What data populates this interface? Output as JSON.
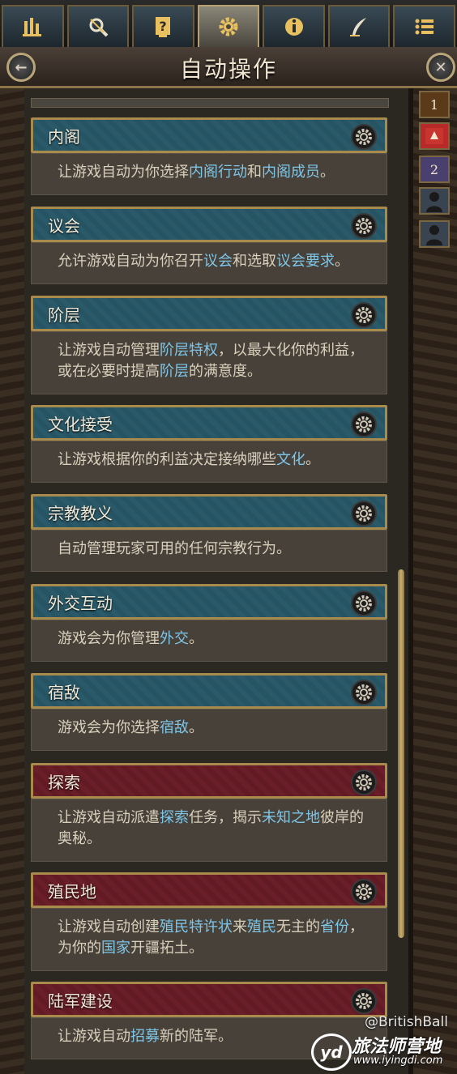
{
  "tabs": [
    {
      "icon": "bar-chart-icon"
    },
    {
      "icon": "magnifier-icon"
    },
    {
      "icon": "question-book-icon"
    },
    {
      "icon": "gear-icon"
    },
    {
      "icon": "info-icon"
    },
    {
      "icon": "quill-icon"
    },
    {
      "icon": "list-icon"
    }
  ],
  "header": {
    "title": "自动操作",
    "back_icon": "back-arrow-icon",
    "close_icon": "close-icon"
  },
  "side": {
    "badge1": "1",
    "badge2": "2"
  },
  "colors": {
    "blue_header": "#2a5a6a",
    "red_header": "#6a1e28",
    "highlight": "#7ec6e8",
    "text": "#d9d0bc",
    "gold": "#a88a4c"
  },
  "items": [
    {
      "title": "内阁",
      "style": "blue",
      "desc": [
        {
          "t": "让游戏自动为你选择"
        },
        {
          "t": "内阁行动",
          "h": true
        },
        {
          "t": "和"
        },
        {
          "t": "内阁成员",
          "h": true
        },
        {
          "t": "。"
        }
      ]
    },
    {
      "title": "议会",
      "style": "blue",
      "desc": [
        {
          "t": "允许游戏自动为你召开"
        },
        {
          "t": "议会",
          "h": true
        },
        {
          "t": "和选取"
        },
        {
          "t": "议会要求",
          "h": true
        },
        {
          "t": "。"
        }
      ]
    },
    {
      "title": "阶层",
      "style": "blue",
      "desc": [
        {
          "t": "让游戏自动管理"
        },
        {
          "t": "阶层特权",
          "h": true
        },
        {
          "t": "，以最大化你的利益，或在必要时提高"
        },
        {
          "t": "阶层",
          "h": true
        },
        {
          "t": "的满意度。"
        }
      ]
    },
    {
      "title": "文化接受",
      "style": "blue",
      "desc": [
        {
          "t": "让游戏根据你的利益决定接纳哪些"
        },
        {
          "t": "文化",
          "h": true
        },
        {
          "t": "。"
        }
      ]
    },
    {
      "title": "宗教教义",
      "style": "blue",
      "desc": [
        {
          "t": "自动管理玩家可用的任何宗教行为。"
        }
      ]
    },
    {
      "title": "外交互动",
      "style": "blue",
      "desc": [
        {
          "t": "游戏会为你管理"
        },
        {
          "t": "外交",
          "h": true
        },
        {
          "t": "。"
        }
      ]
    },
    {
      "title": "宿敌",
      "style": "blue",
      "desc": [
        {
          "t": "游戏会为你选择"
        },
        {
          "t": "宿敌",
          "h": true
        },
        {
          "t": "。"
        }
      ]
    },
    {
      "title": "探索",
      "style": "red",
      "desc": [
        {
          "t": "让游戏自动派遣"
        },
        {
          "t": "探索",
          "h": true
        },
        {
          "t": "任务，揭示"
        },
        {
          "t": "未知之地",
          "h": true
        },
        {
          "t": "彼岸的奥秘。"
        }
      ]
    },
    {
      "title": "殖民地",
      "style": "red",
      "desc": [
        {
          "t": "让游戏自动创建"
        },
        {
          "t": "殖民特许状",
          "h": true
        },
        {
          "t": "来"
        },
        {
          "t": "殖民",
          "h": true
        },
        {
          "t": "无主的"
        },
        {
          "t": "省份",
          "h": true
        },
        {
          "t": "，为你的"
        },
        {
          "t": "国家",
          "h": true
        },
        {
          "t": "开疆拓土。"
        }
      ]
    },
    {
      "title": "陆军建设",
      "style": "red",
      "desc": [
        {
          "t": "让游戏自动"
        },
        {
          "t": "招募",
          "h": true
        },
        {
          "t": "新的陆军。"
        }
      ]
    }
  ],
  "watermark": {
    "handle": "@BritishBall",
    "logo": "yd",
    "site_name": "旅法师营地",
    "site_url": "www.iyingdi.com"
  }
}
